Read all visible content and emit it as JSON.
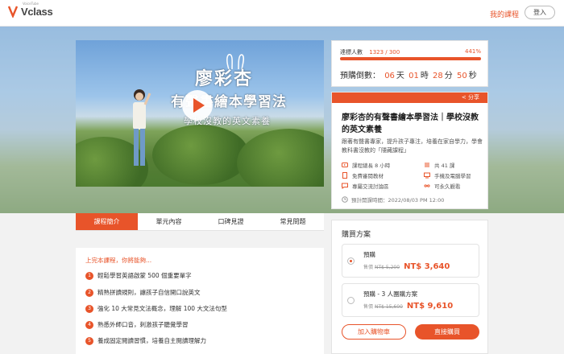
{
  "header": {
    "logo_text": "Vclass",
    "logo_sub": "VoiceTube",
    "my_courses": "我的課程",
    "login": "登入"
  },
  "video": {
    "title_line1": "廖彩杏",
    "title_line2": "有聲書繪本學習法",
    "title_line3": "學校沒教的英文素養"
  },
  "stats": {
    "label": "達標人數",
    "count": "1323 / 300",
    "percent_text": "441%",
    "progress_fraction": 1.0,
    "countdown": {
      "prefix": "預購倒數：",
      "days": "06",
      "days_unit": "天",
      "hours": "01",
      "hours_unit": "時",
      "minutes": "28",
      "minutes_unit": "分",
      "seconds": "50",
      "seconds_unit": "秒"
    }
  },
  "info": {
    "share": "分享",
    "title": "廖彩杏的有聲書繪本學習法｜學校沒教的英文素養",
    "desc": "跟著有聲書專家，提升孩子專注，培養在家自學力，學會教科書沒教的「隱藏課程」",
    "features": [
      {
        "icon": "video-icon",
        "label": "課程總長 8 小時"
      },
      {
        "icon": "list-icon",
        "label": "共 41 課"
      },
      {
        "icon": "file-icon",
        "label": "免費審閱教材"
      },
      {
        "icon": "device-icon",
        "label": "手機及電腦學習"
      },
      {
        "icon": "chat-icon",
        "label": "專屬交流討論區"
      },
      {
        "icon": "infinity-icon",
        "label": "可永久觀看"
      }
    ],
    "launch": "預計開課時間：2022/08/03 PM 12:00"
  },
  "tabs": [
    {
      "label": "課程簡介",
      "active": true
    },
    {
      "label": "單元內容",
      "active": false
    },
    {
      "label": "口碑見證",
      "active": false
    },
    {
      "label": "常見問題",
      "active": false
    }
  ],
  "learn": {
    "title": "上完本課程，你將能夠...",
    "items": [
      "輕鬆學習英語啟蒙 500 個重要單字",
      "精熟拼讀規則，讓孩子自信開口說英文",
      "強化 10 大常見文法概念，理解 100 大文法句型",
      "熟悉外師口音，刺激孩子聽覺學習",
      "養成固定閱讀習慣，培養自主閱讀理解力"
    ]
  },
  "purchase": {
    "title": "購買方案",
    "plans": [
      {
        "name": "預購",
        "label": "售價",
        "original": "NT$ 5,200",
        "price": "NT$ 3,640",
        "selected": true
      },
      {
        "name": "預購 - 3 人團購方案",
        "label": "售價",
        "original": "NT$ 15,600",
        "price": "NT$ 9,610",
        "selected": false
      }
    ],
    "cart": "加入購物車",
    "buy": "直接購買"
  },
  "colors": {
    "accent": "#e8542a"
  }
}
